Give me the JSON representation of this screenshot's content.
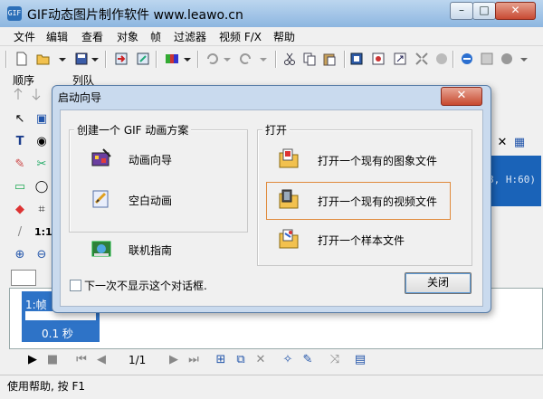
{
  "window": {
    "title": "GIF动态图片制作软件 www.leawo.cn",
    "app_icon": "GIF"
  },
  "window_buttons": {
    "minimize": "–",
    "maximize": "□",
    "close": "✕"
  },
  "menu": [
    "文件",
    "编辑",
    "查看",
    "对象",
    "帧",
    "过滤器",
    "视频 F/X",
    "帮助"
  ],
  "toolbar": {
    "icons": [
      "new-icon",
      "open-icon",
      "dropdown-icon",
      "save-icon",
      "dropdown-icon",
      "import-icon",
      "export-icon",
      "palette-icon",
      "dropdown-icon",
      "undo-icon",
      "dropdown-icon",
      "redo-icon",
      "dropdown-icon",
      "cut-icon",
      "copy-icon",
      "paste-icon",
      "crop-icon",
      "rotate-icon",
      "resize-icon",
      "shrink-icon",
      "flip-icon",
      "browser-icon",
      "preview-icon",
      "optimize-icon"
    ]
  },
  "panel_labels": {
    "order": "顺序",
    "queue": "列队"
  },
  "canvas": {
    "size_text": "8, H:60)"
  },
  "frames": {
    "frame_label": "1:帧",
    "delay": "0.1 秒"
  },
  "playbar": {
    "counter": "1/1"
  },
  "status": {
    "text": "使用帮助, 按 F1"
  },
  "dialog": {
    "title": "启动向导",
    "create_group": {
      "title": "创建一个 GIF 动画方案",
      "options": [
        {
          "label": "动画向导",
          "icon": "wizard-icon"
        },
        {
          "label": "空白动画",
          "icon": "blank-animation-icon"
        }
      ]
    },
    "online_guide": {
      "label": "联机指南",
      "icon": "online-guide-icon"
    },
    "open_group": {
      "title": "打开",
      "options": [
        {
          "label": "打开一个现有的图象文件",
          "icon": "open-image-icon"
        },
        {
          "label": "打开一个现有的视频文件",
          "icon": "open-video-icon"
        },
        {
          "label": "打开一个样本文件",
          "icon": "open-sample-icon"
        }
      ]
    },
    "dont_show_label": "下一次不显示这个对话框.",
    "dont_show_checked": false,
    "close_label": "关闭",
    "close_x": "✕"
  },
  "colors": {
    "accent": "#2e73c7",
    "highlight_border": "#e08a3c",
    "dialog_frame": "#c9daee"
  }
}
